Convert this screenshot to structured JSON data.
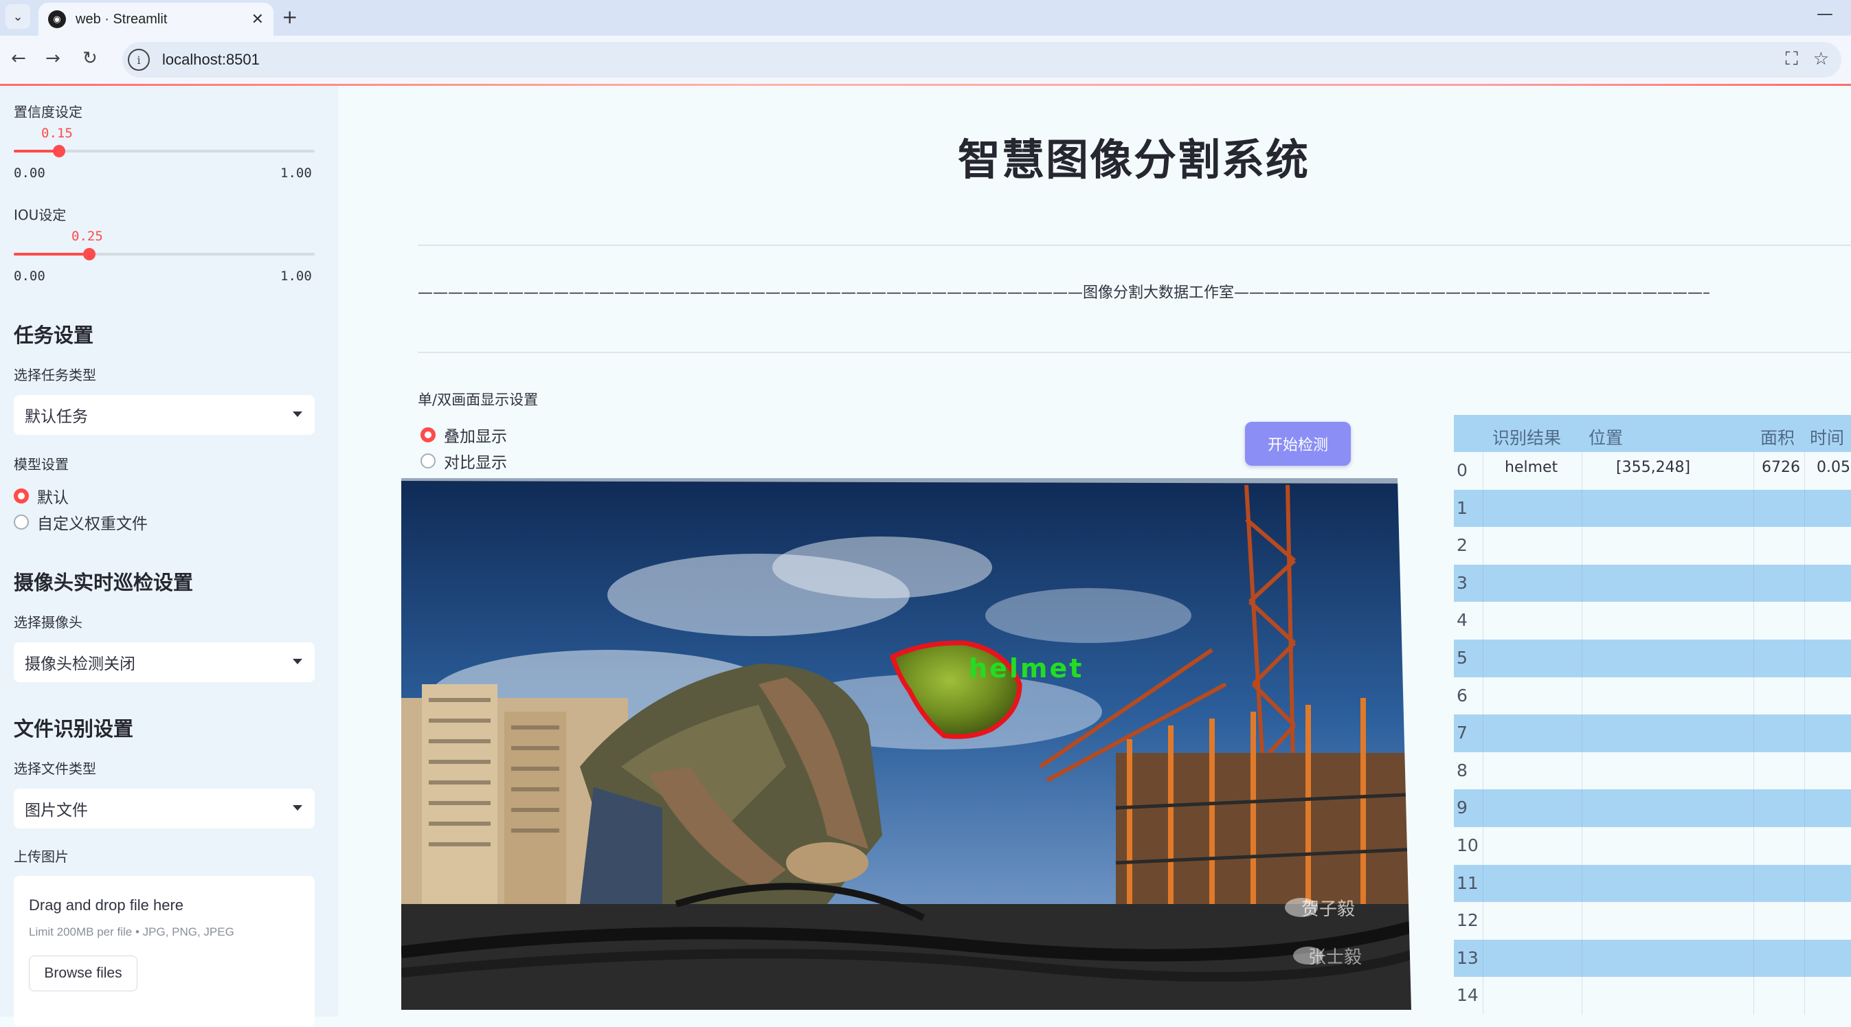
{
  "browser": {
    "tab_title": "web · Streamlit",
    "url": "localhost:8501"
  },
  "sidebar": {
    "conf_label": "置信度设定",
    "conf_value": "0.15",
    "conf_value_num": 0.15,
    "conf_min": "0.00",
    "conf_max": "1.00",
    "iou_label": "IOU设定",
    "iou_value": "0.25",
    "iou_value_num": 0.25,
    "iou_min": "0.00",
    "iou_max": "1.00",
    "task_heading": "任务设置",
    "task_type_label": "选择任务类型",
    "task_type_value": "默认任务",
    "model_label": "模型设置",
    "model_options": [
      "默认",
      "自定义权重文件"
    ],
    "camera_heading": "摄像头实时巡检设置",
    "camera_label": "选择摄像头",
    "camera_value": "摄像头检测关闭",
    "file_heading": "文件识别设置",
    "file_type_label": "选择文件类型",
    "file_type_value": "图片文件",
    "upload_label": "上传图片",
    "upload_title": "Drag and drop file here",
    "upload_limit": "Limit 200MB per file • JPG, PNG, JPEG",
    "upload_button": "Browse files"
  },
  "main": {
    "title": "智慧图像分割系统",
    "divider_text": "————————————————————————————————————————————图像分割大数据工作室————————————————————————————————————————————",
    "display_label": "单/双画面显示设置",
    "display_options": [
      "叠加显示",
      "对比显示"
    ],
    "start_button": "开始检测",
    "detection_label": "helmet"
  },
  "table": {
    "headers": [
      "识别结果",
      "位置",
      "面积",
      "时间"
    ],
    "rows": [
      {
        "idx": "0",
        "result": "helmet",
        "position": "[355,248]",
        "area": "6726",
        "time": "0.05"
      },
      {
        "idx": "1"
      },
      {
        "idx": "2"
      },
      {
        "idx": "3"
      },
      {
        "idx": "4"
      },
      {
        "idx": "5"
      },
      {
        "idx": "6"
      },
      {
        "idx": "7"
      },
      {
        "idx": "8"
      },
      {
        "idx": "9"
      },
      {
        "idx": "10"
      },
      {
        "idx": "11"
      },
      {
        "idx": "12"
      },
      {
        "idx": "13"
      },
      {
        "idx": "14"
      }
    ]
  },
  "colors": {
    "accent": "#ff4b4b",
    "button": "#8b8ef5",
    "table_stripe": "#a8d4f4",
    "mask_outline": "#e8141c",
    "label_green": "#22dd22"
  }
}
